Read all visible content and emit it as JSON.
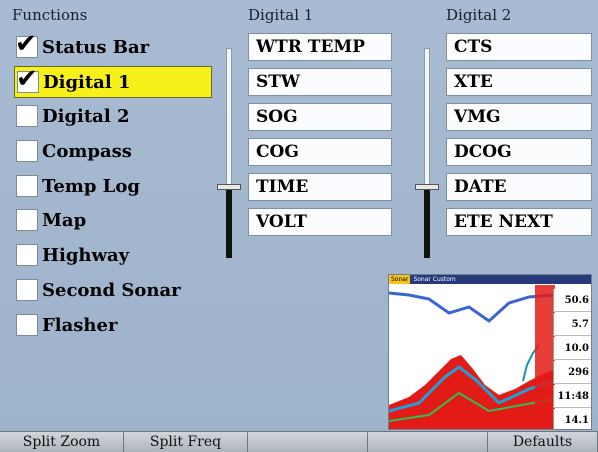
{
  "functions": {
    "header": "Functions",
    "items": [
      {
        "label": "Status Bar",
        "checked": true,
        "selected": false
      },
      {
        "label": "Digital 1",
        "checked": true,
        "selected": true
      },
      {
        "label": "Digital 2",
        "checked": false,
        "selected": false
      },
      {
        "label": "Compass",
        "checked": false,
        "selected": false
      },
      {
        "label": "Temp Log",
        "checked": false,
        "selected": false
      },
      {
        "label": "Map",
        "checked": false,
        "selected": false
      },
      {
        "label": "Highway",
        "checked": false,
        "selected": false
      },
      {
        "label": "Second Sonar",
        "checked": false,
        "selected": false
      },
      {
        "label": "Flasher",
        "checked": false,
        "selected": false
      }
    ]
  },
  "digital1": {
    "header": "Digital 1",
    "fields": [
      "WTR TEMP",
      "STW",
      "SOG",
      "COG",
      "TIME",
      "VOLT"
    ]
  },
  "digital2": {
    "header": "Digital 2",
    "fields": [
      "CTS",
      "XTE",
      "VMG",
      "DCOG",
      "DATE",
      "ETE NEXT"
    ]
  },
  "preview": {
    "title_tag": "Sonar",
    "title": "Sonar Custom",
    "values": [
      "50.6",
      "5.7",
      "10.0",
      "296",
      "11:48",
      "14.1"
    ]
  },
  "softkeys": [
    "Split Zoom",
    "Split Freq",
    "",
    "",
    "Defaults"
  ],
  "colors": {
    "selection": "#f7f01a",
    "background": "#a8bbd2"
  }
}
